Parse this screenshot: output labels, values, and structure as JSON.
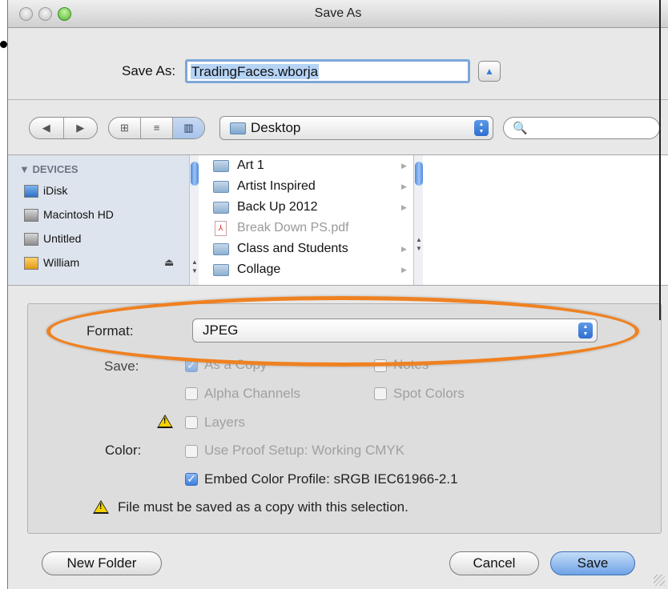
{
  "window": {
    "title": "Save As"
  },
  "save_as": {
    "label": "Save As:",
    "filename": "TradingFaces.wborja",
    "expand_symbol": "▲"
  },
  "toolbar": {
    "nav": [
      "◀",
      "▶"
    ],
    "views": [
      "⊞",
      "≡",
      "▥"
    ],
    "location": "Desktop",
    "search_value": "",
    "search_icon": "🔍"
  },
  "sidebar": {
    "section": "▼ DEVICES",
    "items": [
      {
        "label": "iDisk",
        "icon": "idisk-icon"
      },
      {
        "label": "Macintosh HD",
        "icon": "hard-drive-icon"
      },
      {
        "label": "Untitled",
        "icon": "hard-drive-icon"
      },
      {
        "label": "William",
        "icon": "home-icon"
      }
    ],
    "eject": "⏏"
  },
  "files": [
    {
      "name": "Art 1",
      "type": "folder",
      "enabled": true
    },
    {
      "name": "Artist Inspired",
      "type": "folder",
      "enabled": true
    },
    {
      "name": "Back Up 2012",
      "type": "folder",
      "enabled": true
    },
    {
      "name": "Break Down PS.pdf",
      "type": "pdf",
      "enabled": false
    },
    {
      "name": "Class and Students",
      "type": "folder",
      "enabled": true
    },
    {
      "name": "Collage",
      "type": "folder",
      "enabled": true
    }
  ],
  "options": {
    "format_label": "Format:",
    "format_value": "JPEG",
    "save_label": "Save:",
    "as_a_copy": "As a Copy",
    "notes": "Notes",
    "alpha_channels": "Alpha Channels",
    "spot_colors": "Spot Colors",
    "layers": "Layers",
    "color_label": "Color:",
    "use_proof_setup": "Use Proof Setup:  Working CMYK",
    "embed_color_profile": "Embed Color Profile:  sRGB IEC61966-2.1",
    "warning_text": "File must be saved as a copy with this selection.",
    "warn_symbol": "!"
  },
  "buttons": {
    "new_folder": "New Folder",
    "cancel": "Cancel",
    "save": "Save"
  },
  "colors": {
    "highlight_ellipse": "#ef8121",
    "default_button": "#6ea3e6"
  }
}
